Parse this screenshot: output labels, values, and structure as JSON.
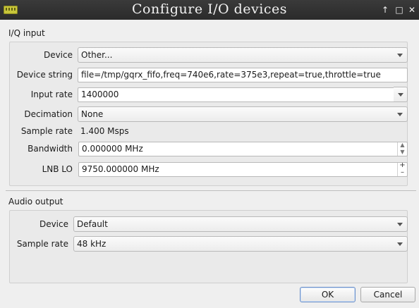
{
  "window": {
    "title": "Configure I/O devices"
  },
  "iq_input": {
    "section_title": "I/Q input",
    "device_label": "Device",
    "device_value": "Other...",
    "device_string_label": "Device string",
    "device_string_value": "file=/tmp/gqrx_fifo,freq=740e6,rate=375e3,repeat=true,throttle=true",
    "input_rate_label": "Input rate",
    "input_rate_value": "1400000",
    "decimation_label": "Decimation",
    "decimation_value": "None",
    "sample_rate_label": "Sample rate",
    "sample_rate_value": "1.400 Msps",
    "bandwidth_label": "Bandwidth",
    "bandwidth_value": "0.000000 MHz",
    "lnb_lo_label": "LNB LO",
    "lnb_lo_value": "9750.000000 MHz"
  },
  "audio_output": {
    "section_title": "Audio output",
    "device_label": "Device",
    "device_value": "Default",
    "sample_rate_label": "Sample rate",
    "sample_rate_value": "48 kHz"
  },
  "buttons": {
    "ok": "OK",
    "cancel": "Cancel"
  }
}
